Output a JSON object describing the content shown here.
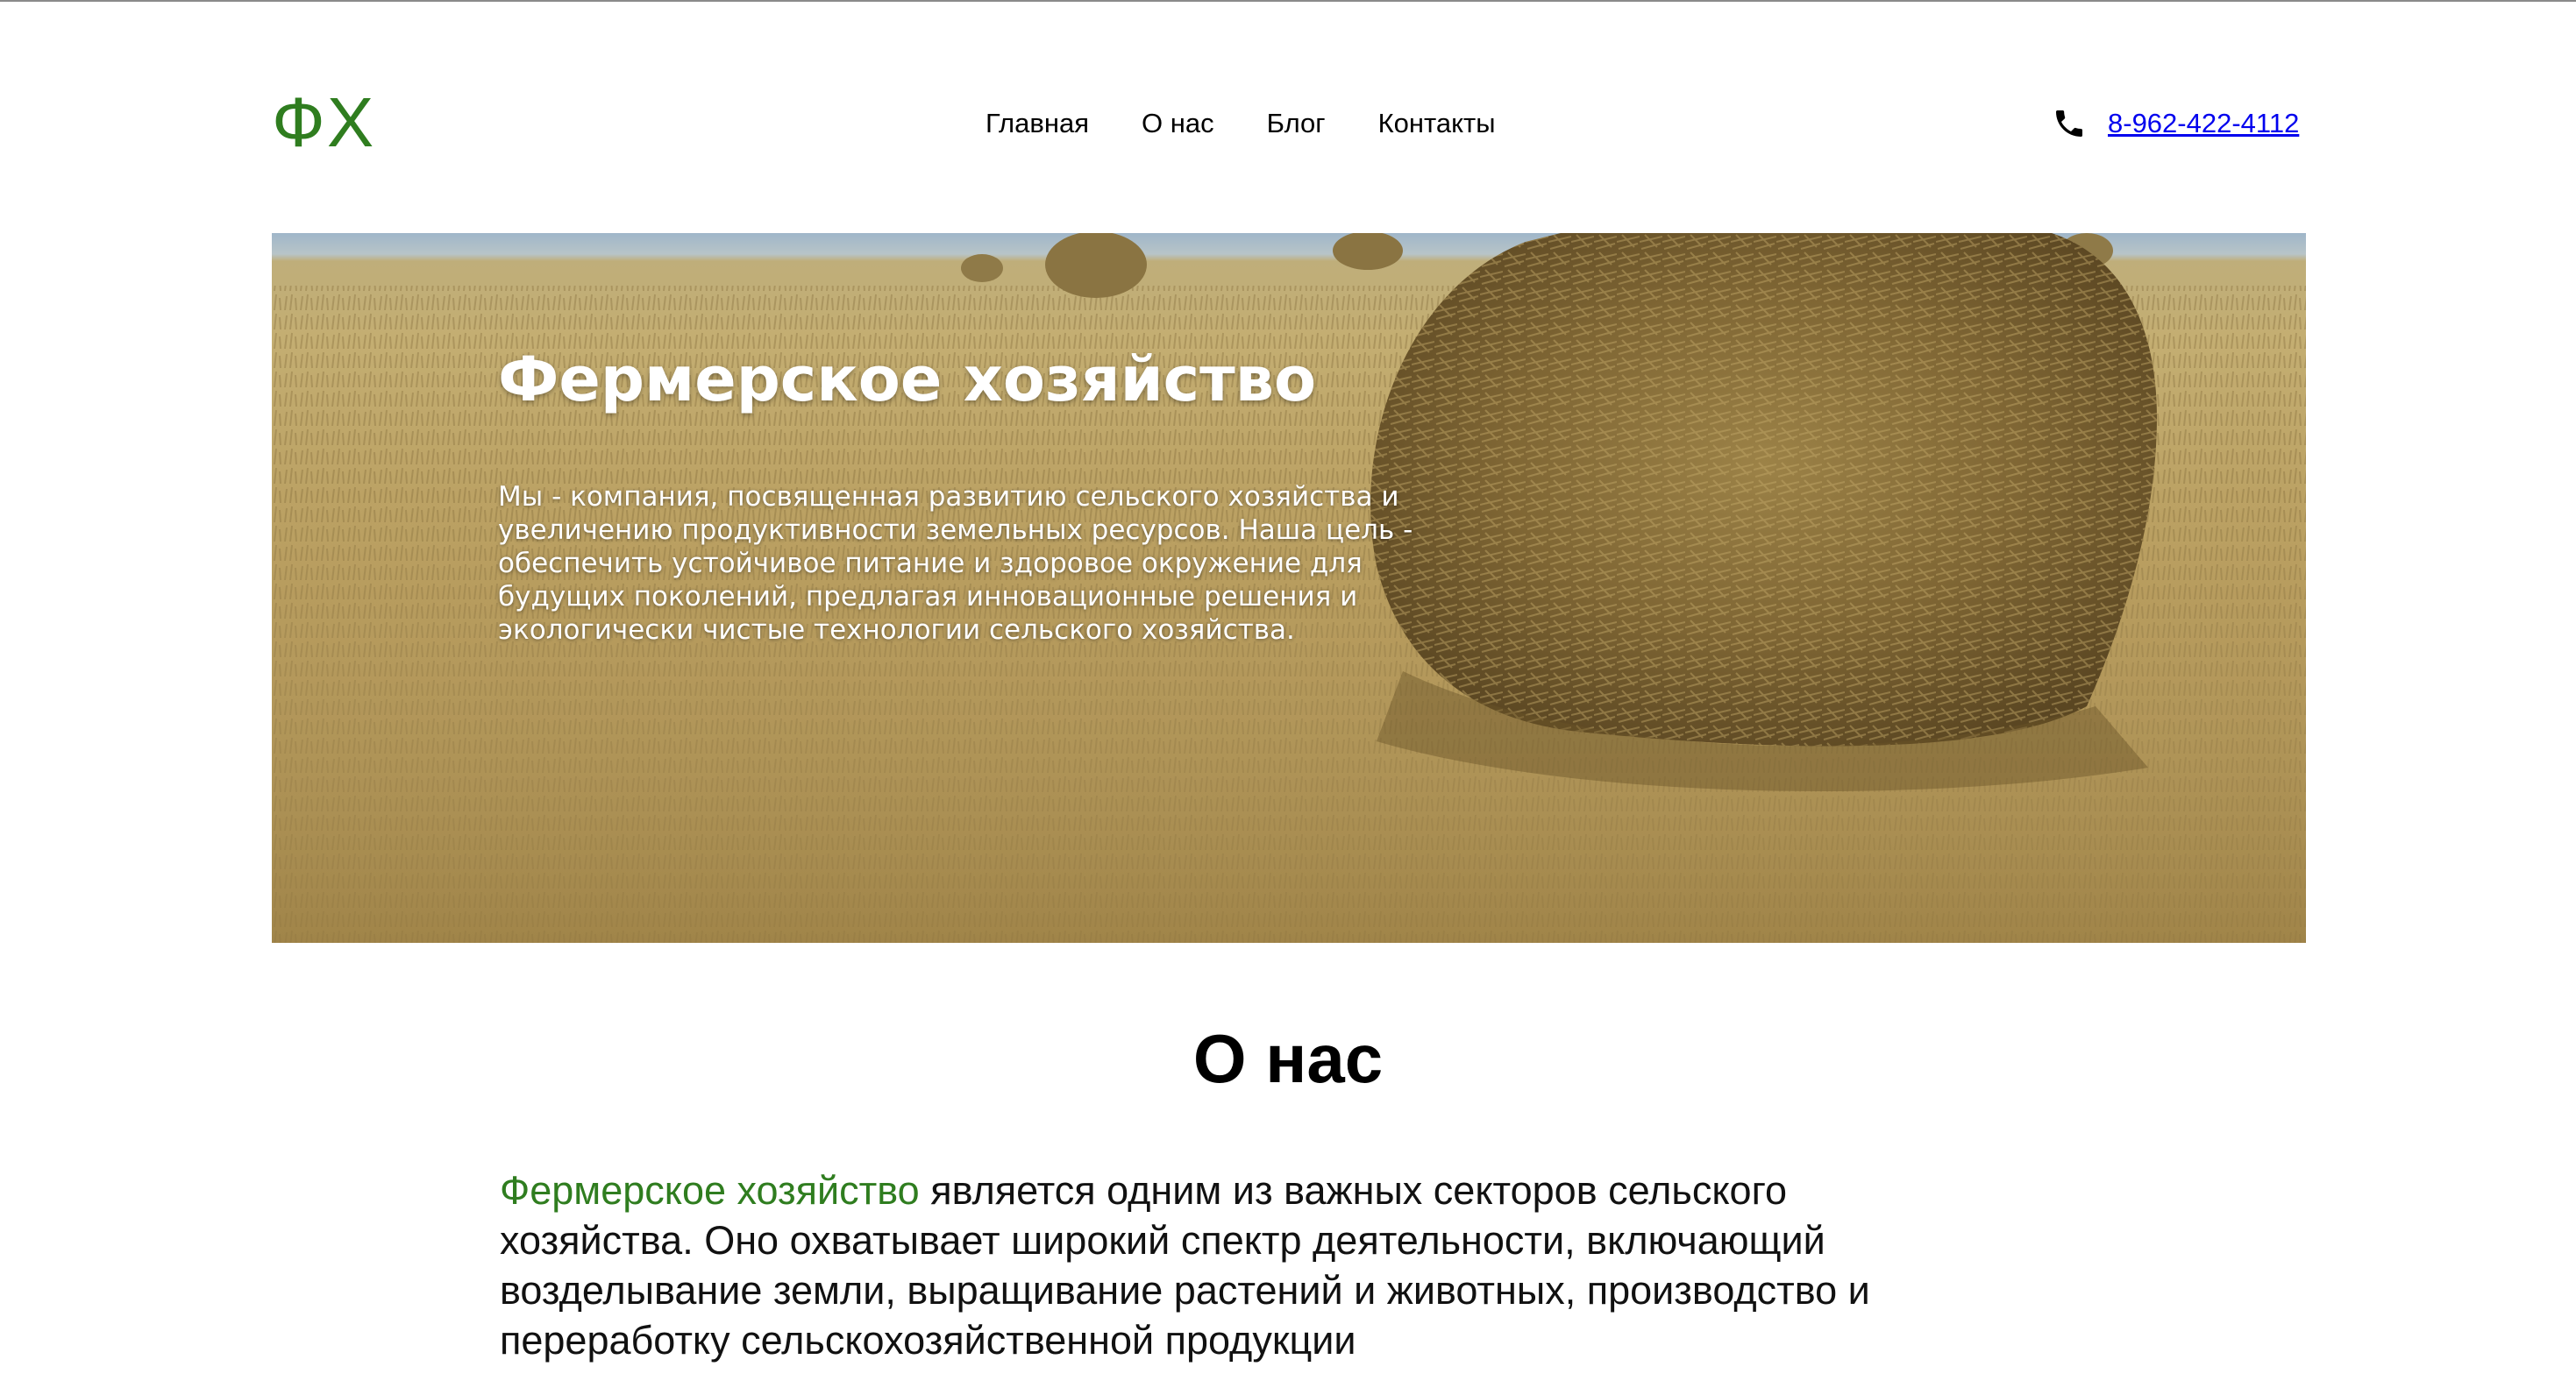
{
  "header": {
    "logo": "ФХ",
    "nav": [
      "Главная",
      "О нас",
      "Блог",
      "Контакты"
    ],
    "phone": "8-962-422-4112",
    "phone_icon": "phone-icon"
  },
  "hero": {
    "title": "Фермерское хозяйство",
    "description": "Мы - компания, посвященная развитию сельского хозяйства и увеличению продуктивности земельных ресурсов. Наша цель - обеспечить устойчивое питание и здоровое окружение для будущих поколений, предлагая инновационные решения и экологически чистые технологии сельского хозяйства.",
    "image": "hay-bale-field-photo"
  },
  "about": {
    "title": "О нас",
    "highlight": "Фермерское хозяйство",
    "text": " является одним из важных секторов сельского хозяйства. Оно охватывает широкий спектр деятельности, включающий возделывание земли, выращивание растений и животных, производство и переработку сельскохозяйственной продукции"
  },
  "colors": {
    "accent": "#2f7d1f",
    "link": "#0000ee",
    "text": "#111111"
  }
}
